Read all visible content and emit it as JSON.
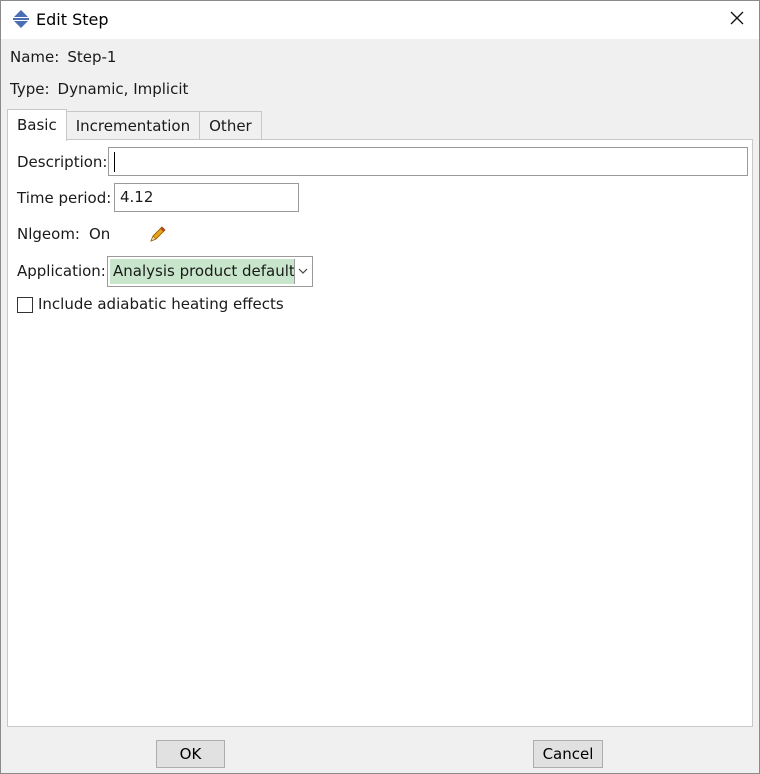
{
  "window": {
    "title": "Edit Step",
    "icon": "step-icon",
    "close_icon": "close-icon"
  },
  "step": {
    "name_label": "Name:",
    "name_value": "Step-1",
    "type_label": "Type:",
    "type_value": "Dynamic, Implicit"
  },
  "tabs": [
    {
      "label": "Basic",
      "active": true
    },
    {
      "label": "Incrementation",
      "active": false
    },
    {
      "label": "Other",
      "active": false
    }
  ],
  "basic": {
    "description_label": "Description:",
    "description_value": "",
    "time_period_label": "Time period:",
    "time_period_value": "4.12",
    "nlgeom_label": "Nlgeom:",
    "nlgeom_value": "On",
    "edit_icon": "pencil-icon",
    "application_label": "Application:",
    "application_value": "Analysis product default",
    "adiabatic_label": "Include adiabatic heating effects",
    "adiabatic_checked": false
  },
  "buttons": {
    "ok": "OK",
    "cancel": "Cancel"
  },
  "colors": {
    "selection_highlight": "#c8e6cc",
    "pencil": "#e8a317"
  }
}
